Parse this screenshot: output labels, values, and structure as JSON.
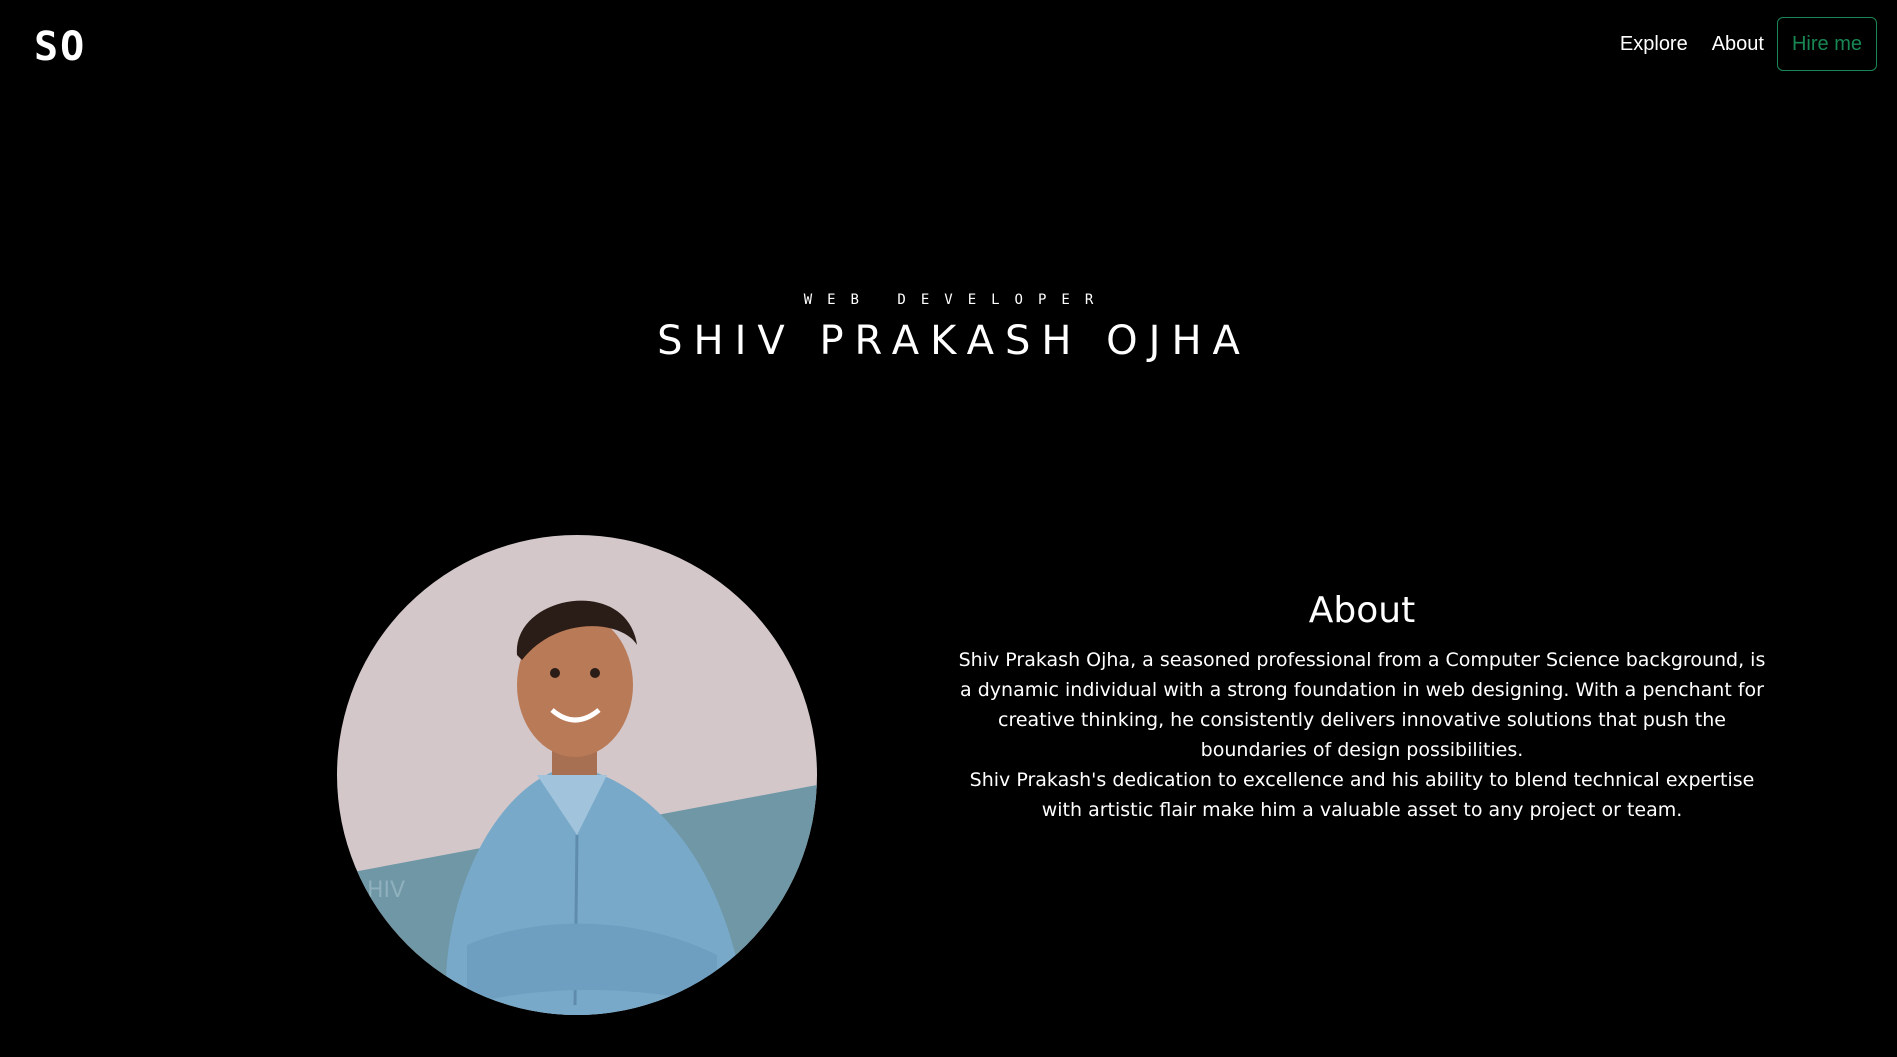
{
  "logo": {
    "text": "SO"
  },
  "nav": {
    "explore_label": "Explore",
    "about_label": "About",
    "hire_label": "Hire me"
  },
  "hero": {
    "subtitle": "WEB DEVELOPER",
    "name": "SHIV PRAKASH OJHA"
  },
  "about": {
    "heading": "About",
    "paragraph_1": "Shiv Prakash Ojha, a seasoned professional from a Computer Science background, is a dynamic individual with a strong foundation in web designing. With a penchant for creative thinking, he consistently delivers innovative solutions that push the boundaries of design possibilities.",
    "paragraph_2": "Shiv Prakash's dedication to excellence and his ability to blend technical expertise with artistic flair make him a valuable asset to any project or team."
  },
  "colors": {
    "background": "#000000",
    "text": "#ffffff",
    "accent": "#198754",
    "avatar_wall": "#d3c7c9",
    "avatar_shirt": "#79a9c9",
    "avatar_floor": "#6f97a6"
  },
  "icons": {
    "avatar": "profile-photo"
  }
}
